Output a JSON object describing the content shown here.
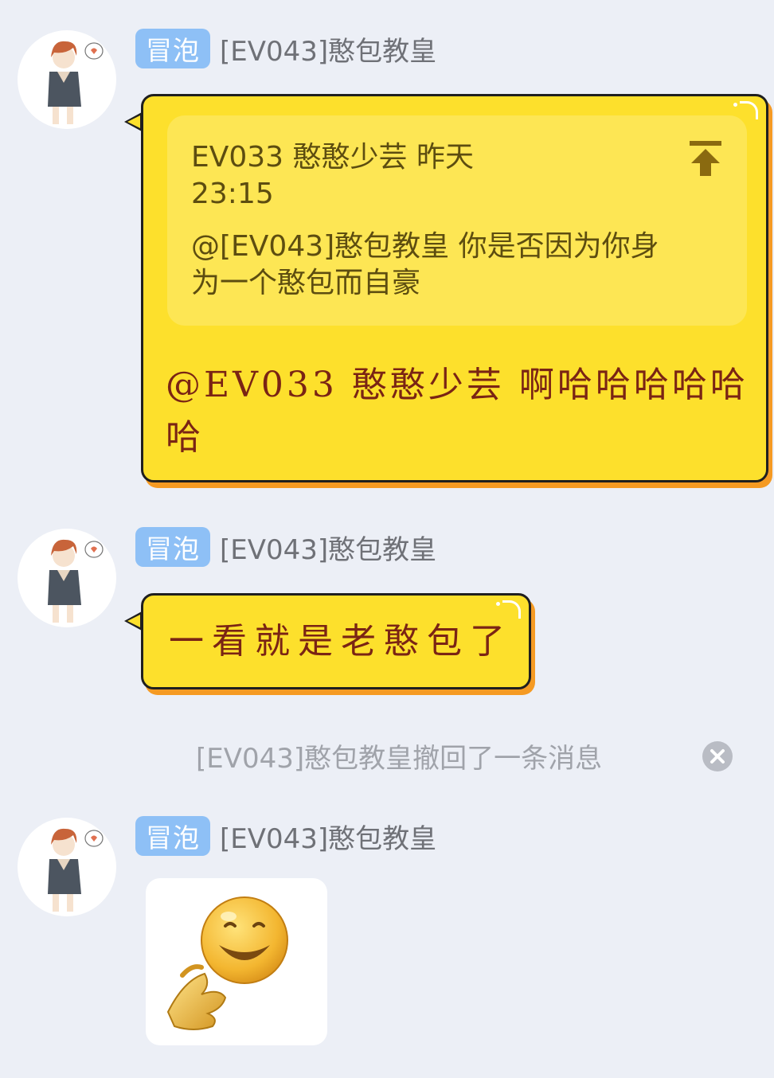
{
  "messages": [
    {
      "badge": "冒泡",
      "sender": "[EV043]憨包教皇",
      "quote": {
        "header": "EV033 憨憨少芸 昨天 23:15",
        "text": "@[EV043]憨包教皇 你是否因为你身为一个憨包而自豪"
      },
      "text": "@EV033 憨憨少芸 啊哈哈哈哈哈哈"
    },
    {
      "badge": "冒泡",
      "sender": "[EV043]憨包教皇",
      "text": "一看就是老憨包了"
    },
    {
      "badge": "冒泡",
      "sender": "[EV043]憨包教皇",
      "image": "smiley-sticker"
    }
  ],
  "system_notice": "[EV043]憨包教皇撤回了一条消息",
  "icons": [
    "jump-to-quote-icon",
    "close-icon",
    "avatar-icon",
    "smiley-sticker"
  ],
  "colors": {
    "background": "#eceff6",
    "bubble": "#fde02c",
    "bubble_shadow": "#f59a23",
    "badge": "#8ec0f6",
    "bubble_text": "#7a2414"
  }
}
